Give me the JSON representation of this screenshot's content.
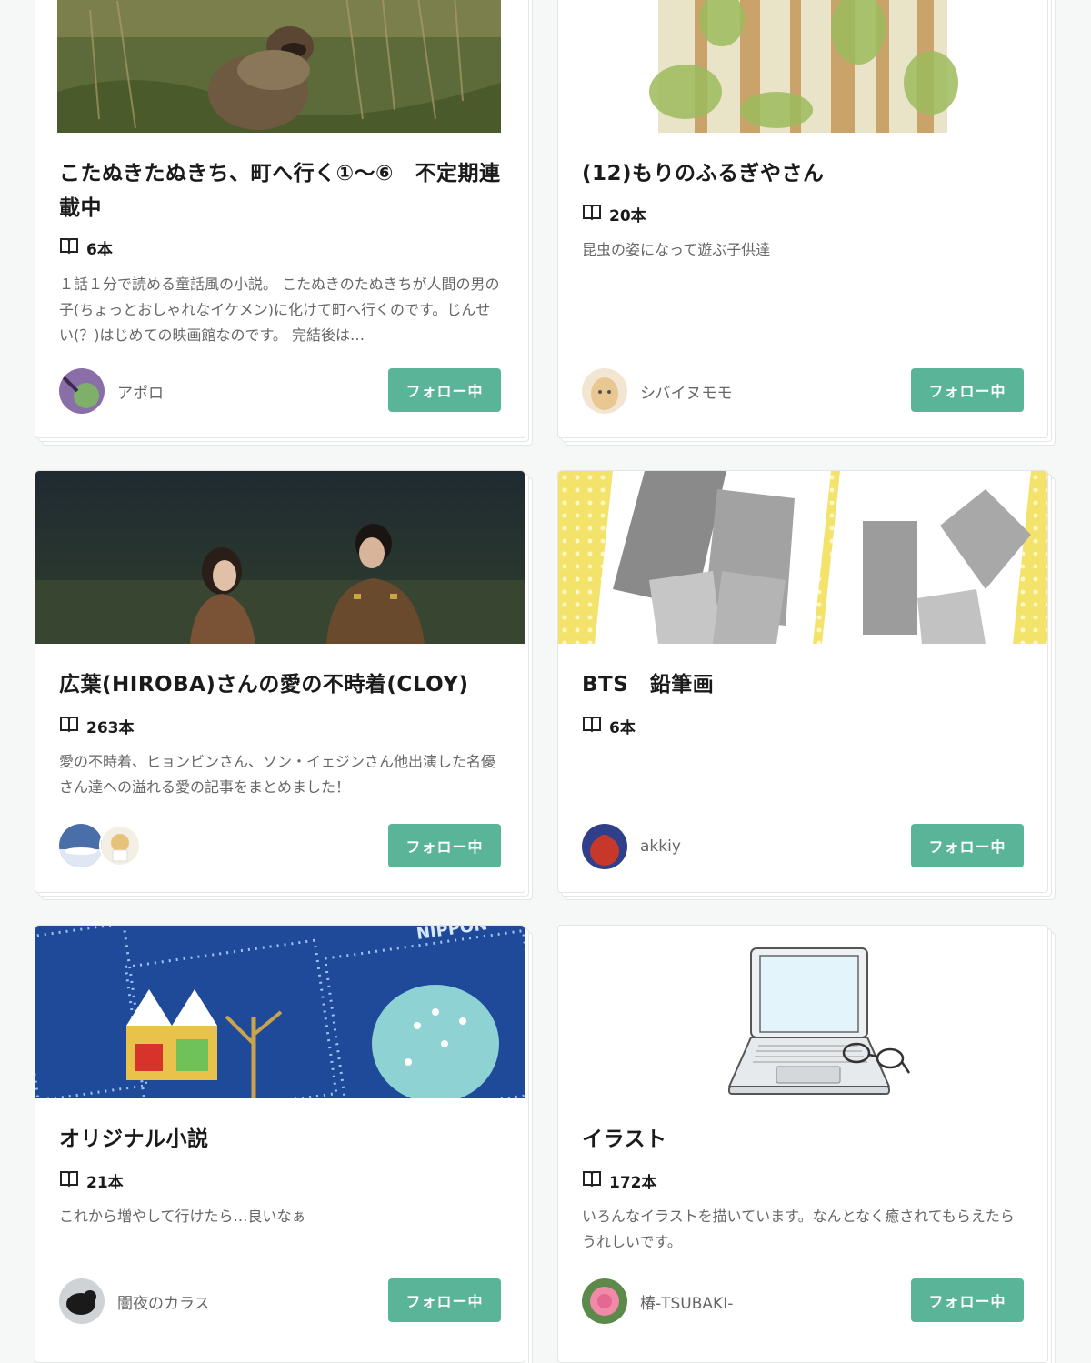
{
  "follow_label": "フォロー中",
  "magazines": [
    {
      "title": "こたぬきたぬきち、町へ行く①〜⑥　不定期連載中",
      "count": "6本",
      "description": "１話１分で読める童話風の小説。 こたぬきのたぬきちが人間の男の子(ちょっとおしゃれなイケメン)に化けて町へ行くのです。じんせい(？)はじめての映画館なのです。 完結後は…",
      "author": "アポロ"
    },
    {
      "title": "(12)もりのふるぎやさん",
      "count": "20本",
      "description": "昆虫の姿になって遊ぶ子供達",
      "author": "シバイヌモモ"
    },
    {
      "title": "広葉(HIROBA)さんの愛の不時着(CLOY)",
      "count": "263本",
      "description": "愛の不時着、ヒョンビンさん、ソン・イェジンさん他出演した名優さん達への溢れる愛の記事をまとめました！",
      "author": ""
    },
    {
      "title": "BTS　鉛筆画",
      "count": "6本",
      "description": "",
      "author": "akkiy"
    },
    {
      "title": "オリジナル小説",
      "count": "21本",
      "description": "これから増やして行けたら…良いなぁ",
      "author": "闇夜のカラス"
    },
    {
      "title": "イラスト",
      "count": "172本",
      "description": "いろんなイラストを描いています。なんとなく癒されてもらえたらうれしいです。",
      "author": "椿-TSUBAKI-"
    }
  ],
  "colors": {
    "follow_button": "#5ab497",
    "background": "#f6f7f7"
  },
  "icons": {
    "count": "book-open-icon"
  }
}
